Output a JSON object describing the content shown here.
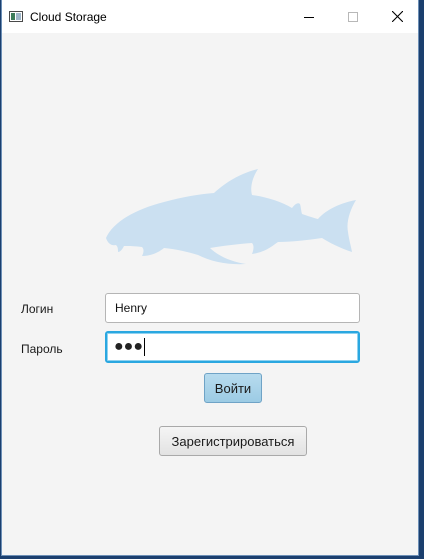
{
  "window": {
    "title": "Cloud Storage"
  },
  "form": {
    "login_label": "Логин",
    "login_value": "Henry",
    "password_label": "Пароль",
    "password_mask": "●●●",
    "login_button": "Войти",
    "register_button": "Зарегистрироваться"
  },
  "icons": {
    "app": "window-app-icon",
    "logo": "shark-logo",
    "minimize": "minimize-icon",
    "maximize": "maximize-icon",
    "close": "close-icon"
  },
  "colors": {
    "logo": "#cbe0f1",
    "focus_border": "#2aa7e0",
    "primary_button": "#a9d3ea",
    "background": "#f4f4f4"
  }
}
